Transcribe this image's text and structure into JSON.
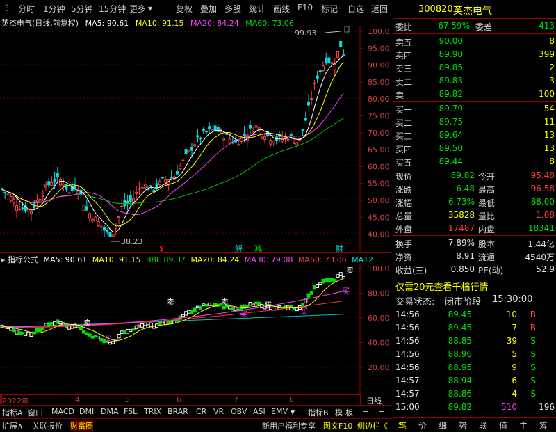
{
  "toolbar": {
    "items": [
      "分时",
      "1分钟",
      "5分钟",
      "15分钟",
      "更多",
      "复权",
      "叠加",
      "多股",
      "统计",
      "画线",
      "F10",
      "标记",
      "自选",
      "返回"
    ],
    "dropdown_icon": "triangle-down"
  },
  "main": {
    "stock_label": "英杰电气(日线,前复权)",
    "ma5": "MA5: 90.61",
    "ma10": "MA10: 91.15",
    "ma20": "MA20: 84.24",
    "ma60": "MA60: 73.06",
    "high_marker": "99.93",
    "low_marker": "38.23",
    "y_ticks": [
      "100.0",
      "95.00",
      "90.00",
      "85.00",
      "80.00",
      "75.00",
      "70.00",
      "65.00",
      "60.00",
      "55.00",
      "50.00",
      "45.00",
      "40.00"
    ],
    "event_marks": [
      "$",
      "解",
      "减",
      "财"
    ]
  },
  "sub": {
    "title": "指标公式",
    "ma5": "MA5: 90.61",
    "ma10": "MA10: 91.15",
    "bbi": "BBI: 89.37",
    "ma20": "MA20: 84.24",
    "ma30": "MA30: 79.08",
    "ma60": "MA60: 73.06",
    "ma12": "MA12",
    "y_ticks": [
      "100.0",
      "80.00",
      "60.00",
      "40.00",
      "20.00"
    ],
    "sell_marks": [
      "卖",
      "卖",
      "卖",
      "卖",
      "卖"
    ],
    "buy_marks": [
      "买",
      "买",
      "买",
      "买"
    ]
  },
  "date_axis": {
    "labels": [
      "2022年",
      "4",
      "5",
      "6",
      "7",
      "8"
    ],
    "right_label": "日线"
  },
  "tabs_row1": [
    "指标A",
    "窗口",
    "MACD",
    "DMI",
    "DMA",
    "FSL",
    "TRIX",
    "BRAR",
    "CR",
    "VR",
    "OBV",
    "ASI",
    "EMV",
    "指标B",
    "模",
    "板",
    "+",
    "−"
  ],
  "tabs_row2": [
    "扩展∧",
    "关联报价",
    "财富圈",
    "新用户福利专享",
    "图文F10",
    "侧边栏《"
  ],
  "quote": {
    "code": "300820",
    "name": "英杰电气",
    "weibi_label": "委比",
    "weibi": "-67.59%",
    "weicha_label": "委差",
    "weicha": "-413",
    "asks": [
      {
        "label": "卖五",
        "price": "90.00",
        "vol": "8"
      },
      {
        "label": "卖四",
        "price": "89.90",
        "vol": "399"
      },
      {
        "label": "卖三",
        "price": "89.85",
        "vol": "2"
      },
      {
        "label": "卖二",
        "price": "89.83",
        "vol": "3"
      },
      {
        "label": "卖一",
        "price": "89.82",
        "vol": "100"
      }
    ],
    "bids": [
      {
        "label": "买一",
        "price": "89.79",
        "vol": "54"
      },
      {
        "label": "买二",
        "price": "89.75",
        "vol": "11"
      },
      {
        "label": "买三",
        "price": "89.64",
        "vol": "13"
      },
      {
        "label": "买四",
        "price": "89.50",
        "vol": "13"
      },
      {
        "label": "买五",
        "price": "89.44",
        "vol": "8"
      }
    ],
    "stats": [
      {
        "l1": "现价",
        "v1": "89.82",
        "c1": "g",
        "l2": "今开",
        "v2": "95.48",
        "c2": "r"
      },
      {
        "l1": "涨跌",
        "v1": "-6.48",
        "c1": "g",
        "l2": "最高",
        "v2": "96.58",
        "c2": "r"
      },
      {
        "l1": "涨幅",
        "v1": "-6.73%",
        "c1": "g",
        "l2": "最低",
        "v2": "88.00",
        "c2": "g"
      },
      {
        "l1": "总量",
        "v1": "35828",
        "c1": "y",
        "l2": "量比",
        "v2": "1.08",
        "c2": "r"
      },
      {
        "l1": "外盘",
        "v1": "17487",
        "c1": "r",
        "l2": "内盘",
        "v2": "18341",
        "c2": "g"
      }
    ],
    "fund": [
      {
        "l1": "换手",
        "v1": "7.89%",
        "l2": "股本",
        "v2": "1.44亿"
      },
      {
        "l1": "净资",
        "v1": "8.91",
        "l2": "流通",
        "v2": "4540万"
      },
      {
        "l1": "收益(三)",
        "v1": "0.850",
        "l2": "PE(动)",
        "v2": "52.9"
      }
    ],
    "promo": "仅需20元查看千档行情",
    "status_label": "交易状态:",
    "status": "闭市阶段",
    "status_time": "15:30:00"
  },
  "ticks": [
    {
      "t": "14:56",
      "p": "89.45",
      "v": "10",
      "s": "B"
    },
    {
      "t": "14:56",
      "p": "89.45",
      "v": "7",
      "s": "B"
    },
    {
      "t": "14:56",
      "p": "88.85",
      "v": "39",
      "s": "S"
    },
    {
      "t": "14:56",
      "p": "88.96",
      "v": "5",
      "s": "S"
    },
    {
      "t": "14:56",
      "p": "88.95",
      "v": "9",
      "s": "S"
    },
    {
      "t": "14:57",
      "p": "88.94",
      "v": "6",
      "s": "S"
    },
    {
      "t": "14:57",
      "p": "88.86",
      "v": "4",
      "s": "S"
    },
    {
      "t": "15:00",
      "p": "89.82",
      "v": "510",
      "s": "196"
    }
  ],
  "right_tabs": [
    "笔",
    "价",
    "细",
    "势",
    "联",
    "值",
    "主",
    "筹"
  ]
}
